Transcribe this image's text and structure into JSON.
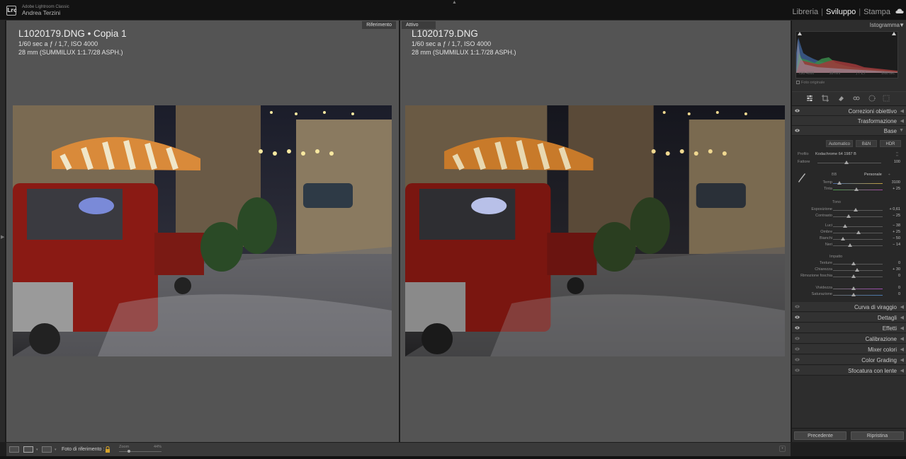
{
  "app": {
    "logo": "Lrc",
    "name": "Adobe Lightroom Classic",
    "user": "Andrea Terzini"
  },
  "modules": [
    {
      "label": "Libreria",
      "active": false
    },
    {
      "label": "Sviluppo",
      "active": true
    },
    {
      "label": "Stampa",
      "active": false
    }
  ],
  "compare": {
    "left": {
      "tag": "Riferimento",
      "filename": "L1020179.DNG  •  Copia 1",
      "exposure": "1/60 sec a ƒ / 1,7, ISO 4000",
      "lens": "28 mm (SUMMILUX 1:1.7/28 ASPH.)"
    },
    "right": {
      "tag": "Attivo",
      "filename": "L1020179.DNG",
      "exposure": "1/60 sec a ƒ / 1,7, ISO 4000",
      "lens": "28 mm (SUMMILUX 1:1.7/28 ASPH.)"
    }
  },
  "toolbar": {
    "reference_photo_label": "Foto di riferimento :",
    "zoom_label": "Zoom",
    "zoom_value": "44%"
  },
  "histogram": {
    "title": "Istogramma",
    "iso": "ISO 4000",
    "focal": "28 mm",
    "aperture": "ƒ / 1,7",
    "shutter": "1/60 sec",
    "original_photo": "Foto originale"
  },
  "panels": {
    "lens_corrections": "Correzioni obiettivo",
    "transform": "Trasformazione",
    "basic": "Base",
    "tone_curve": "Curva di viraggio",
    "detail": "Dettagli",
    "effects": "Effetti",
    "calibration": "Calibrazione",
    "color_mixer": "Mixer colori",
    "color_grading": "Color Grading",
    "lens_blur": "Sfocatura con lente"
  },
  "basic": {
    "auto": "Automatico",
    "bw": "B&N",
    "hdr": "HDR",
    "profile_label": "Profilo",
    "profile_value": "Kodachrome 64 1987 B",
    "amount_label": "Fattore",
    "amount_value": "100",
    "wb_label": "BB",
    "wb_value": "Personale",
    "temp_label": "Temp",
    "temp_value": "3100",
    "tint_label": "Tinta",
    "tint_value": "+ 25",
    "tone_title": "Tono",
    "exposure_label": "Esposizione",
    "exposure_value": "+ 0,61",
    "contrast_label": "Contrasto",
    "contrast_value": "− 25",
    "highlights_label": "Luci",
    "highlights_value": "− 38",
    "shadows_label": "Ombre",
    "shadows_value": "+ 25",
    "whites_label": "Bianchi",
    "whites_value": "− 50",
    "blacks_label": "Neri",
    "blacks_value": "− 14",
    "presence_title": "Impatto",
    "texture_label": "Texture",
    "texture_value": "0",
    "clarity_label": "Chiarezza",
    "clarity_value": "+ 30",
    "dehaze_label": "Rimozione foschia",
    "dehaze_value": "0",
    "vibrance_label": "Vividezza",
    "vibrance_value": "0",
    "saturation_label": "Saturazione",
    "saturation_value": "0"
  },
  "buttons": {
    "previous": "Precedente",
    "reset": "Ripristina"
  },
  "colors": {
    "accent": "#f2f2f2",
    "panel_bg": "#2d2d2d",
    "compare_bg": "#545454"
  }
}
